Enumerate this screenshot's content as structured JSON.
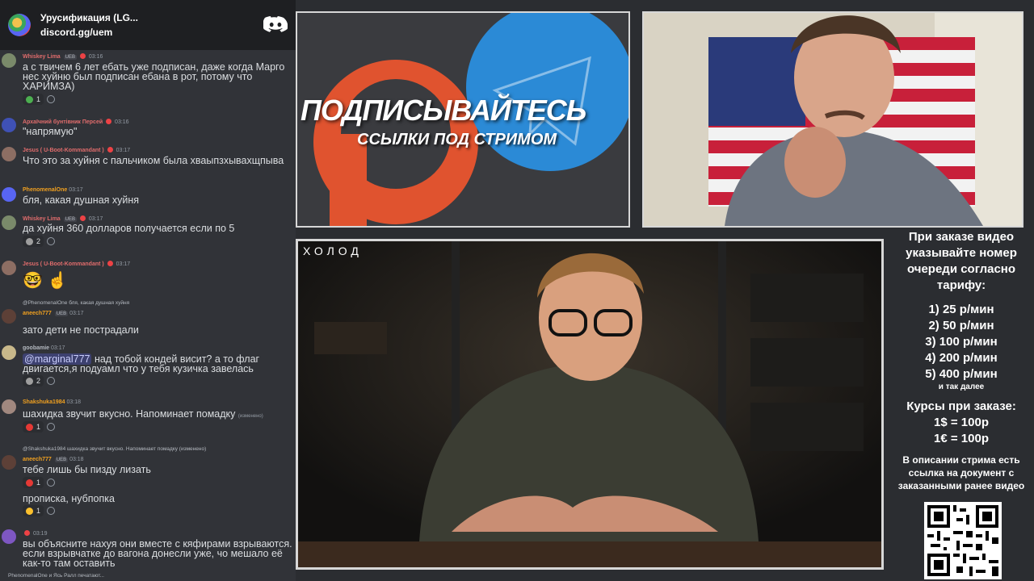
{
  "header": {
    "server_name": "Урусификация (LG...",
    "invite": "discord.gg/uem"
  },
  "messages": [
    {
      "user": "Whiskey Lima",
      "badge": "UEB",
      "time": "03:16",
      "text": "а с твичем 6 лет ебать уже подписан, даже когда Марго нес хуйню был подписан ебана в рот, потому что ХАРИМЗА)",
      "reaction_count": "1"
    },
    {
      "user": "Архаїчний бунтівник Персей",
      "time": "03:16",
      "text": "\"напрямую\""
    },
    {
      "user": "Jesus ( U-Boot-Kommandant )",
      "time": "03:17",
      "text": "Что это за хуйня с пальчиком была хваыпзхывахщпыва"
    },
    {
      "user": "PhenomenalOne",
      "time": "03:17",
      "text": "бля, какая душная хуйня"
    },
    {
      "user": "Whiskey Lima",
      "badge": "UEB",
      "time": "03:17",
      "text": "да хуйня 360 долларов получается если по 5",
      "reaction_count": "2"
    },
    {
      "user": "Jesus ( U-Boot-Kommandant )",
      "time": "03:17",
      "text": "🤓 ☝"
    },
    {
      "reply": "@PhenomenalOne бля, какая душная хуйня",
      "user": "aneech777",
      "badge": "UEB",
      "time": "03:17",
      "text": "зато дети не пострадали"
    },
    {
      "user": "goobamie",
      "time": "03:17",
      "mention": "@marginal777",
      "text": " над тобой кондей висит? а то флаг двигается,я подуамл что у тебя кузичка завелась",
      "reaction_count": "2"
    },
    {
      "user": "Shakshuka1984",
      "time": "03:18",
      "text": "шахидка звучит вкусно. Напоминает помадку",
      "edited": "(изменено)",
      "reaction_count": "1"
    },
    {
      "reply": "@Shakshuka1984 шахидка звучит вкусно. Напоминает помадку (изменено)",
      "user": "aneech777",
      "badge": "UEB",
      "time": "03:18",
      "text": "тебе лишь бы пизду лизать",
      "reaction_count": "1"
    },
    {
      "text": "прописка, нубпопка",
      "reaction_count": "1"
    },
    {
      "time": "03:19",
      "text": "вы объясните нахуя они вместе с кяфирами взрываются. если взрывчатке до вагона донесли уже, чо мешало её как-то там оставить"
    }
  ],
  "typing": "PhenomenalOne и Ясь Ралл печатают...",
  "banner": {
    "title": "ПОДПИСЫВАЙТЕСЬ",
    "subtitle": "ССЫЛКИ ПОД СТРИМОМ"
  },
  "video": {
    "watermark": "ХОЛОД"
  },
  "info": {
    "heading": "При заказе видео указывайте номер очереди согласно тарифу:",
    "tariffs": [
      "1) 25 р/мин",
      "2) 50 р/мин",
      "3) 100 р/мин",
      "4) 200 р/мин",
      "5) 400 р/мин"
    ],
    "etc": "и так далее",
    "rates_heading": "Курсы при заказе:",
    "rates": [
      "1$ = 100р",
      "1€ = 100р"
    ],
    "note": "В описании стрима есть ссылка на документ с заказанными ранее видео"
  },
  "colors": {
    "discord_bg": "#313338",
    "header_bg": "#1e1f22",
    "blurple": "#5865f2",
    "telegram_blue": "#2b8ad6",
    "patreon_orange": "#e0532f"
  }
}
